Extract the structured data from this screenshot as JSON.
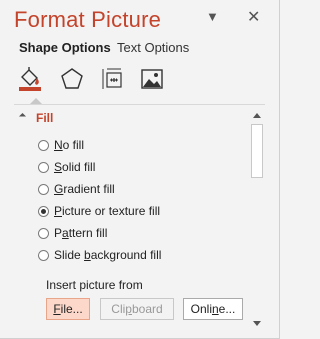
{
  "pane": {
    "title": "Format Picture",
    "dropdown_icon": "chevron-down-icon",
    "close_icon": "close-icon",
    "close_glyph": "✕",
    "dropdown_glyph": "▼"
  },
  "tabs": [
    {
      "label": "Shape Options",
      "selected": true
    },
    {
      "label": "Text Options",
      "selected": false
    }
  ],
  "icon_tabs": [
    {
      "name": "fill-line-icon",
      "selected": true
    },
    {
      "name": "effects-icon",
      "selected": false
    },
    {
      "name": "size-properties-icon",
      "selected": false
    },
    {
      "name": "picture-icon",
      "selected": false
    }
  ],
  "fill": {
    "section_title": "Fill",
    "options": [
      {
        "pre": "",
        "u": "N",
        "post": "o fill",
        "checked": false
      },
      {
        "pre": "",
        "u": "S",
        "post": "olid fill",
        "checked": false
      },
      {
        "pre": "",
        "u": "G",
        "post": "radient fill",
        "checked": false
      },
      {
        "pre": "",
        "u": "P",
        "post": "icture or texture fill",
        "checked": true
      },
      {
        "pre": "P",
        "u": "a",
        "post": "ttern fill",
        "checked": false
      },
      {
        "pre": "Slide ",
        "u": "b",
        "post": "ackground fill",
        "checked": false
      }
    ],
    "insert_label": "Insert picture from",
    "buttons": {
      "file": {
        "pre": "",
        "u": "F",
        "post": "ile..."
      },
      "clipboard": {
        "pre": "Cli",
        "u": "p",
        "post": "board"
      },
      "online": {
        "pre": "Onli",
        "u": "n",
        "post": "e..."
      }
    }
  },
  "colors": {
    "accent": "#c4432b",
    "file_button_bg": "#fbd8c9"
  }
}
